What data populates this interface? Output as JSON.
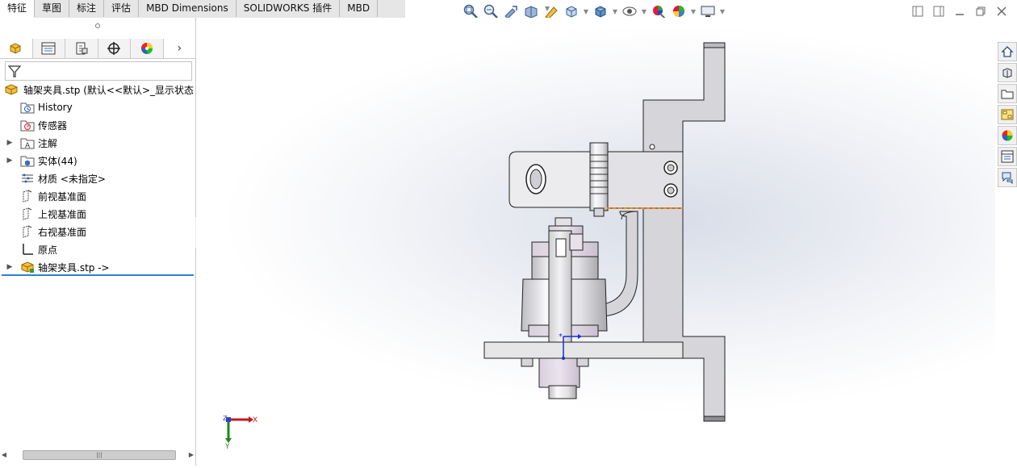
{
  "tabs": [
    {
      "label": "特征",
      "active": true
    },
    {
      "label": "草图"
    },
    {
      "label": "标注"
    },
    {
      "label": "评估"
    },
    {
      "label": "MBD Dimensions"
    },
    {
      "label": "SOLIDWORKS 插件"
    },
    {
      "label": "MBD"
    }
  ],
  "hud_icons": [
    "zoom-to-fit-icon",
    "zoom-to-area-icon",
    "previous-view-icon",
    "section-view-icon",
    "dynamic-annotation-icon",
    "view-orientation-icon",
    "display-style-icon",
    "hide-show-icon",
    "edit-appearance-icon",
    "apply-scene-icon",
    "view-settings-icon"
  ],
  "panel_tabs": [
    "feature-manager-icon",
    "property-manager-icon",
    "configuration-manager-icon",
    "dimxpert-icon",
    "display-manager-icon"
  ],
  "tree": {
    "root": "轴架夹具.stp  (默认<<默认>_显示状态",
    "items": [
      {
        "label": "History",
        "icon": "history-folder-icon",
        "expand": false
      },
      {
        "label": "传感器",
        "icon": "sensors-folder-icon",
        "expand": false
      },
      {
        "label": "注解",
        "icon": "annotations-folder-icon",
        "expand": true
      },
      {
        "label": "实体(44)",
        "icon": "solid-bodies-folder-icon",
        "expand": true
      },
      {
        "label": "材质 <未指定>",
        "icon": "material-icon",
        "expand": false
      },
      {
        "label": "前视基准面",
        "icon": "plane-icon",
        "expand": false
      },
      {
        "label": "上视基准面",
        "icon": "plane-icon",
        "expand": false
      },
      {
        "label": "右视基准面",
        "icon": "plane-icon",
        "expand": false
      },
      {
        "label": "原点",
        "icon": "origin-icon",
        "expand": false
      },
      {
        "label": "轴架夹具.stp ->",
        "icon": "imported-part-icon",
        "expand": true
      }
    ]
  },
  "triad": {
    "x": "X",
    "y": "Y",
    "z": "Z"
  },
  "task_pane": [
    "home-icon",
    "design-library-icon",
    "file-explorer-icon",
    "view-palette-icon",
    "appearances-icon",
    "custom-properties-icon",
    "forum-icon"
  ]
}
